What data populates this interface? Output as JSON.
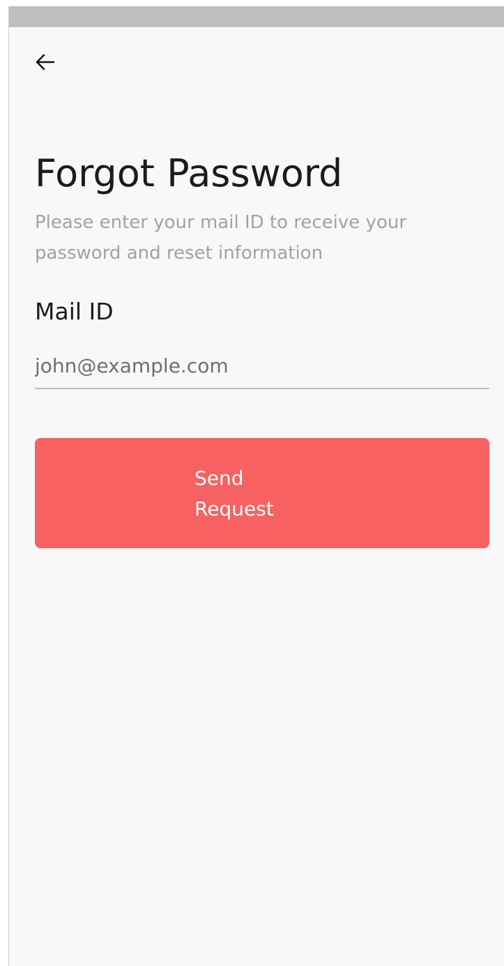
{
  "status_bar": {},
  "header": {
    "back_icon": "arrow-left-icon"
  },
  "main": {
    "title": "Forgot Password",
    "subtitle": "Please enter your mail ID to receive your password and reset information",
    "mail_field": {
      "label": "Mail ID",
      "value": "",
      "placeholder": "john@example.com"
    },
    "send_button": {
      "label": "Send Request"
    }
  },
  "colors": {
    "accent": "#f86162",
    "background": "#f9f8f9",
    "status_bar": "#bebebe",
    "title_text": "#1b1b1b",
    "subtitle_text": "#a2a2a2"
  }
}
